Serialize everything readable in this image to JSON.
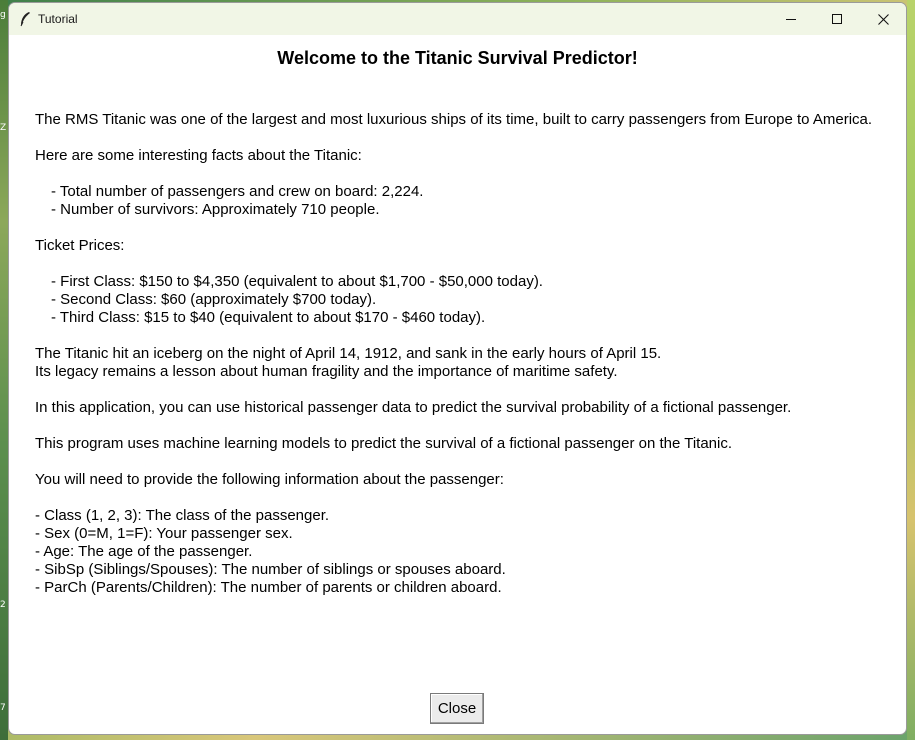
{
  "window": {
    "title": "Tutorial"
  },
  "content": {
    "heading": "Welcome to the Titanic Survival Predictor!",
    "intro": "The RMS Titanic was one of the largest and most luxurious ships of its time, built to carry passengers from Europe to America.",
    "facts_intro": "Here are some interesting facts about the Titanic:",
    "facts": [
      "- Total number of passengers and crew on board: 2,224.",
      "- Number of survivors: Approximately 710 people."
    ],
    "ticket_heading": "Ticket Prices:",
    "tickets": [
      "- First Class: $150 to $4,350 (equivalent to about $1,700 - $50,000 today).",
      "- Second Class: $60 (approximately $700 today).",
      "- Third Class: $15 to $40 (equivalent to about $170 - $460 today)."
    ],
    "history": [
      "The Titanic hit an iceberg on the night of April 14, 1912, and sank in the early hours of April 15.",
      "Its legacy remains a lesson about human fragility and the importance of maritime safety."
    ],
    "app_purpose": "In this application, you can use historical passenger data to predict the survival probability of a fictional passenger.",
    "ml_note": "This program uses machine learning models to predict the survival of a fictional passenger on the Titanic.",
    "input_intro": "You will need to provide the following information about the passenger:",
    "inputs": [
      "- Class (1, 2, 3): The class of the passenger.",
      "- Sex (0=M, 1=F): Your passenger sex.",
      "- Age: The age of the passenger.",
      "- SibSp (Siblings/Spouses): The number of siblings or spouses aboard.",
      "- ParCh (Parents/Children): The number of parents or children aboard."
    ],
    "close_label": "Close"
  },
  "background": {
    "edge_glyphs": [
      "g",
      "Z",
      "2",
      "7"
    ]
  }
}
